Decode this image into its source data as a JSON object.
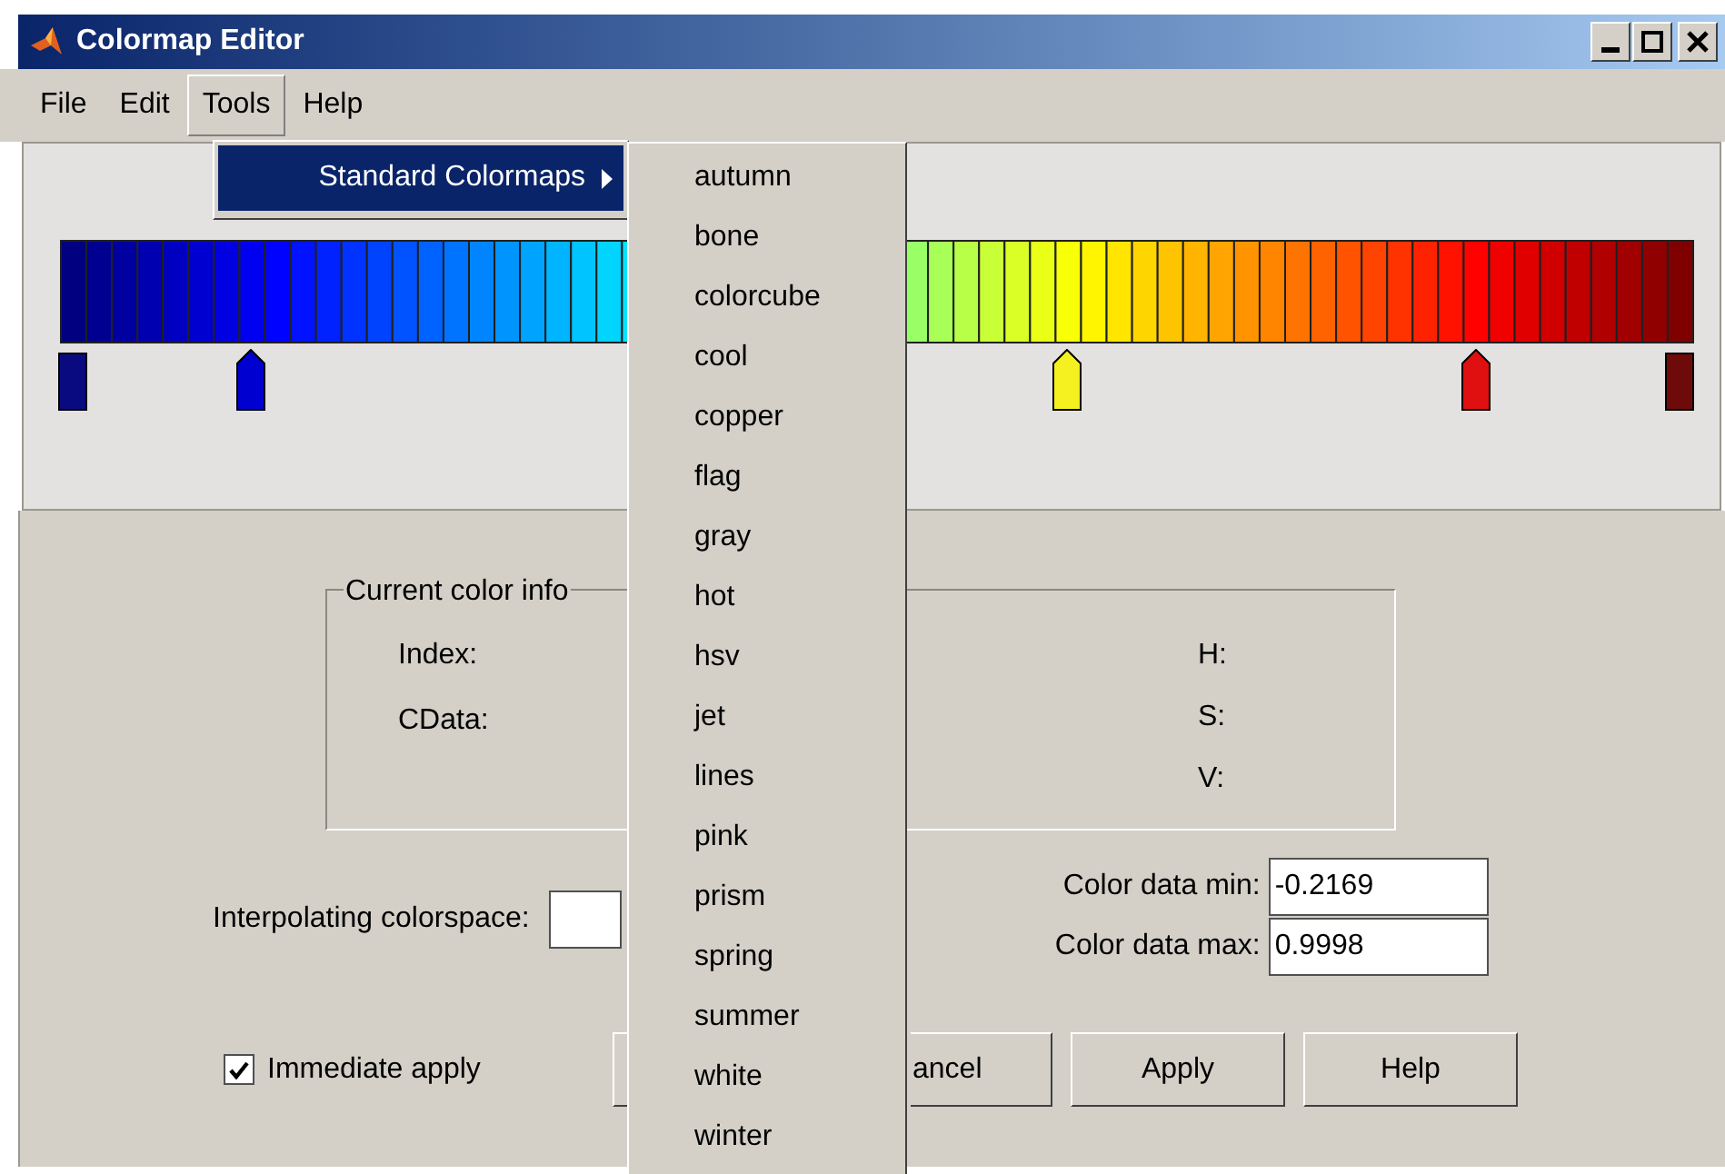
{
  "window": {
    "title": "Colormap Editor"
  },
  "menu_bar": [
    {
      "label": "File",
      "selected": false
    },
    {
      "label": "Edit",
      "selected": false
    },
    {
      "label": "Tools",
      "selected": true
    },
    {
      "label": "Help",
      "selected": false
    }
  ],
  "tools_menu": {
    "items": [
      {
        "label": "Standard Colormaps",
        "selected": true
      }
    ]
  },
  "colormaps_submenu": {
    "items": [
      {
        "label": "autumn"
      },
      {
        "label": "bone"
      },
      {
        "label": "colorcube"
      },
      {
        "label": "cool"
      },
      {
        "label": "copper"
      },
      {
        "label": "flag"
      },
      {
        "label": "gray"
      },
      {
        "label": "hot"
      },
      {
        "label": "hsv"
      },
      {
        "label": "jet"
      },
      {
        "label": "lines"
      },
      {
        "label": "pink"
      },
      {
        "label": "prism"
      },
      {
        "label": "spring"
      },
      {
        "label": "summer"
      },
      {
        "label": "white"
      },
      {
        "label": "winter"
      }
    ]
  },
  "colormap": {
    "markers": [
      {
        "kind": "end",
        "color": "#0a0a80"
      },
      {
        "kind": "node",
        "color": "#0000d0"
      },
      {
        "kind": "node",
        "color": "#f5f020"
      },
      {
        "kind": "node",
        "color": "#e01010"
      },
      {
        "kind": "end",
        "color": "#6e0a0a"
      }
    ]
  },
  "current_color_info": {
    "title": "Current color info",
    "left_labels": [
      "Index:",
      "CData:"
    ],
    "right_labels": [
      "H:",
      "S:",
      "V:"
    ]
  },
  "interpolating_colorspace": {
    "label": "Interpolating colorspace:"
  },
  "color_data": [
    {
      "label": "Color data min:",
      "value": "-0.2169"
    },
    {
      "label": "Color data max:",
      "value": "0.9998"
    }
  ],
  "immediate_apply": {
    "label": "Immediate apply",
    "checked": true
  },
  "buttons": [
    {
      "kind": "covered"
    },
    {
      "kind": "button",
      "label": "ancel"
    },
    {
      "kind": "button",
      "label": "Apply"
    },
    {
      "kind": "button",
      "label": "Help"
    }
  ]
}
